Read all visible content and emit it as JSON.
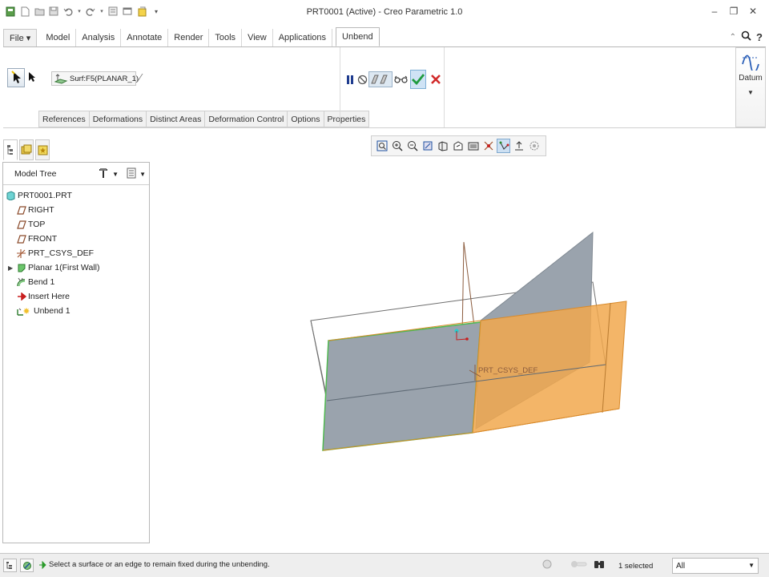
{
  "window": {
    "title": "PRT0001 (Active) - Creo Parametric 1.0"
  },
  "ribbon": {
    "tabs": [
      {
        "label": "File ▾",
        "active": false
      },
      {
        "label": "Model",
        "active": false
      },
      {
        "label": "Analysis",
        "active": false
      },
      {
        "label": "Annotate",
        "active": false
      },
      {
        "label": "Render",
        "active": false
      },
      {
        "label": "Tools",
        "active": false
      },
      {
        "label": "View",
        "active": false
      },
      {
        "label": "Applications",
        "active": false
      },
      {
        "label": "Unbend",
        "active": true
      }
    ],
    "reference_value": "Surf:F5(PLANAR_1)",
    "subtabs": [
      "References",
      "Deformations",
      "Distinct Areas",
      "Deformation Control",
      "Options",
      "Properties"
    ],
    "datum_label": "Datum"
  },
  "model_tree": {
    "header": "Model Tree",
    "items": [
      {
        "label": "PRT0001.PRT",
        "icon": "part-icon"
      },
      {
        "label": "RIGHT",
        "icon": "datum-plane-icon"
      },
      {
        "label": "TOP",
        "icon": "datum-plane-icon"
      },
      {
        "label": "FRONT",
        "icon": "datum-plane-icon"
      },
      {
        "label": "PRT_CSYS_DEF",
        "icon": "csys-icon"
      },
      {
        "label": "Planar 1(First Wall)",
        "icon": "planar-wall-icon"
      },
      {
        "label": "Bend 1",
        "icon": "bend-icon"
      },
      {
        "label": "Insert Here",
        "icon": "insert-here-icon"
      },
      {
        "label": "Unbend 1",
        "icon": "unbend-icon"
      }
    ]
  },
  "graphics": {
    "csys_label": "PRT_CSYS_DEF",
    "colors": {
      "fixed_surface": "#9aa3ad",
      "bent_surface": "#f1a84d",
      "datum_edges": "#8a5a3c",
      "highlight_edge": "#4fb84f"
    }
  },
  "status": {
    "message": "Select a surface or an edge to remain fixed during the unbending.",
    "selected": "1 selected",
    "filter": "All"
  }
}
